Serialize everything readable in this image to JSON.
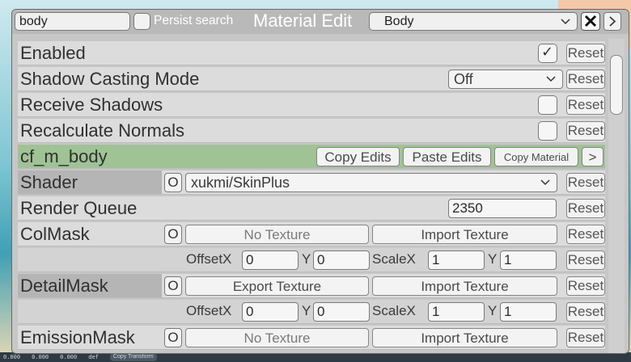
{
  "window": {
    "title": "Material Edit",
    "search": {
      "value": "body"
    },
    "persist_label": "Persist search",
    "object_select": "Body",
    "close_label": "X",
    "next_label": ">"
  },
  "rows": {
    "enabled": {
      "label": "Enabled",
      "checked": "✓"
    },
    "shadow_casting": {
      "label": "Shadow Casting Mode",
      "value": "Off"
    },
    "receive_shadows": {
      "label": "Receive Shadows"
    },
    "recalc_normals": {
      "label": "Recalculate Normals"
    },
    "material": {
      "name": "cf_m_body",
      "copy_edits": "Copy Edits",
      "paste_edits": "Paste Edits",
      "copy_material": "Copy Material",
      "more": ">"
    },
    "shader": {
      "label": "Shader",
      "o": "O",
      "value": "xukmi/SkinPlus"
    },
    "render_queue": {
      "label": "Render Queue",
      "value": "2350"
    },
    "colmask": {
      "label": "ColMask",
      "o": "O",
      "texture": "No Texture",
      "import": "Import Texture",
      "offset_x_label": "OffsetX",
      "offset_x": "0",
      "y_label": "Y",
      "offset_y": "0",
      "scale_x_label": "ScaleX",
      "scale_x": "1",
      "y2_label": "Y",
      "scale_y": "1"
    },
    "detailmask": {
      "label": "DetailMask",
      "o": "O",
      "export": "Export Texture",
      "import": "Import Texture",
      "offset_x_label": "OffsetX",
      "offset_x": "0",
      "y_label": "Y",
      "offset_y": "0",
      "scale_x_label": "ScaleX",
      "scale_x": "1",
      "y2_label": "Y",
      "scale_y": "1"
    },
    "emissionmask": {
      "label": "EmissionMask",
      "o": "O",
      "texture": "No Texture",
      "import": "Import Texture"
    }
  },
  "reset_label": "Reset",
  "background_bar": {
    "v1": "0.000",
    "v2": "0.000",
    "v3": "0.000",
    "tag": "def",
    "button": "Copy Transform"
  }
}
